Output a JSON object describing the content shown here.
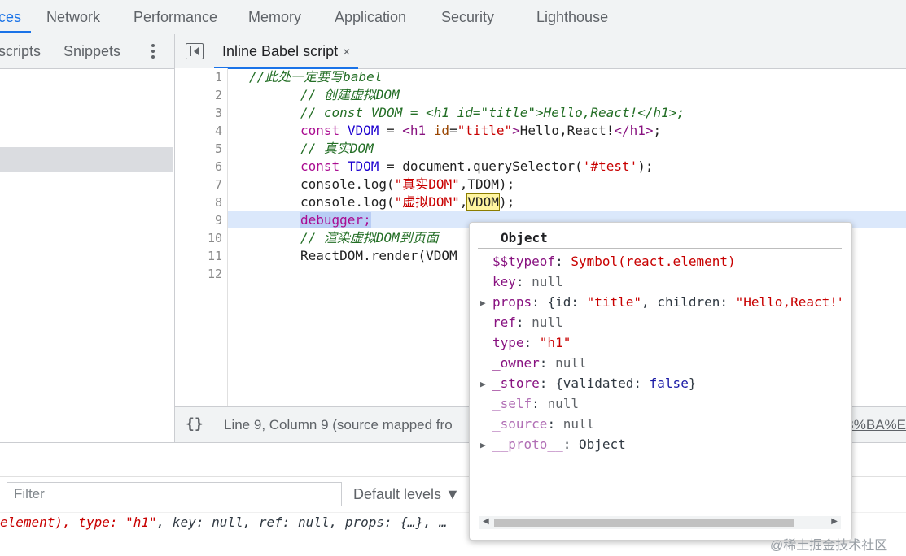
{
  "top_tabs": [
    {
      "label": "ces",
      "active": true
    },
    {
      "label": "Network"
    },
    {
      "label": "Performance"
    },
    {
      "label": "Memory"
    },
    {
      "label": "Application"
    },
    {
      "label": "Security"
    },
    {
      "label": "Lighthouse"
    }
  ],
  "navigator": {
    "tabs": [
      "scripts",
      "Snippets"
    ],
    "more_icon": "more-vertical-icon"
  },
  "editor": {
    "tab_label": "Inline Babel script",
    "tab_close": "×",
    "line_numbers": [
      "1",
      "2",
      "3",
      "4",
      "5",
      "6",
      "7",
      "8",
      "9",
      "10",
      "11",
      "12"
    ],
    "paused_line": 9
  },
  "code": {
    "l1": "//此处一定要写babel",
    "l2": "// 创建虚拟DOM",
    "l3": "// const VDOM = <h1 id=\"title\">Hello,React!</h1>;",
    "l4_kw": "const",
    "l4_var": "VDOM",
    "l4_eq": " = ",
    "l4_tag1": "<h1",
    "l4_attr": "id",
    "l4_eq2": "=",
    "l4_str": "\"title\"",
    "l4_gt": ">",
    "l4_text": "Hello,React!",
    "l4_tag2": "</h1>",
    "l4_semi": ";",
    "l5": "// 真实DOM",
    "l6_kw": "const",
    "l6_var": "TDOM",
    "l6_mid": " = document.querySelector(",
    "l6_str": "'#test'",
    "l6_end": ");",
    "l7_pre": "console.log(",
    "l7_str": "\"真实DOM\"",
    "l7_post": ",TDOM);",
    "l8_pre": "console.log(",
    "l8_str": "\"虚拟DOM\"",
    "l8_comma": ",",
    "l8_var": "VDOM",
    "l8_end": ");",
    "l9": "debugger;",
    "l10": "// 渲染虚拟DOM到页面",
    "l11": "ReactDOM.render(VDOM"
  },
  "status": {
    "braces": "{}",
    "position_text": "Line 9, Column 9  (source mapped fro",
    "link_text": "3%BA%E"
  },
  "console": {
    "filter_placeholder": "Filter",
    "levels_label": "Default levels ▼",
    "log_pre": "element), type: ",
    "log_type": "\"h1\"",
    "log_post": ", key: null, ref: null, props: {…}, …"
  },
  "popover": {
    "title": "Object",
    "props": {
      "typeof_key": "$$typeof",
      "typeof_val": "Symbol(react.element)",
      "key_key": "key",
      "key_val": "null",
      "props_key": "props",
      "props_open": "{id: ",
      "props_id": "\"title\"",
      "props_mid": ", children: ",
      "props_children": "\"Hello,React!\"}",
      "ref_key": "ref",
      "ref_val": "null",
      "type_key": "type",
      "type_val": "\"h1\"",
      "owner_key": "_owner",
      "owner_val": "null",
      "store_key": "_store",
      "store_open": "{validated: ",
      "store_bool": "false",
      "store_close": "}",
      "self_key": "_self",
      "self_val": "null",
      "source_key": "_source",
      "source_val": "null",
      "proto_key": "__proto__",
      "proto_val": "Object"
    },
    "scroll_left": "◀",
    "scroll_right": "▶"
  },
  "watermark": "@稀土掘金技术社区",
  "colors": {
    "accent": "#1a73e8",
    "paused_line_bg": "#dbe8fb",
    "comment": "#236e25",
    "keyword": "#aa0d91",
    "string": "#c80000"
  }
}
